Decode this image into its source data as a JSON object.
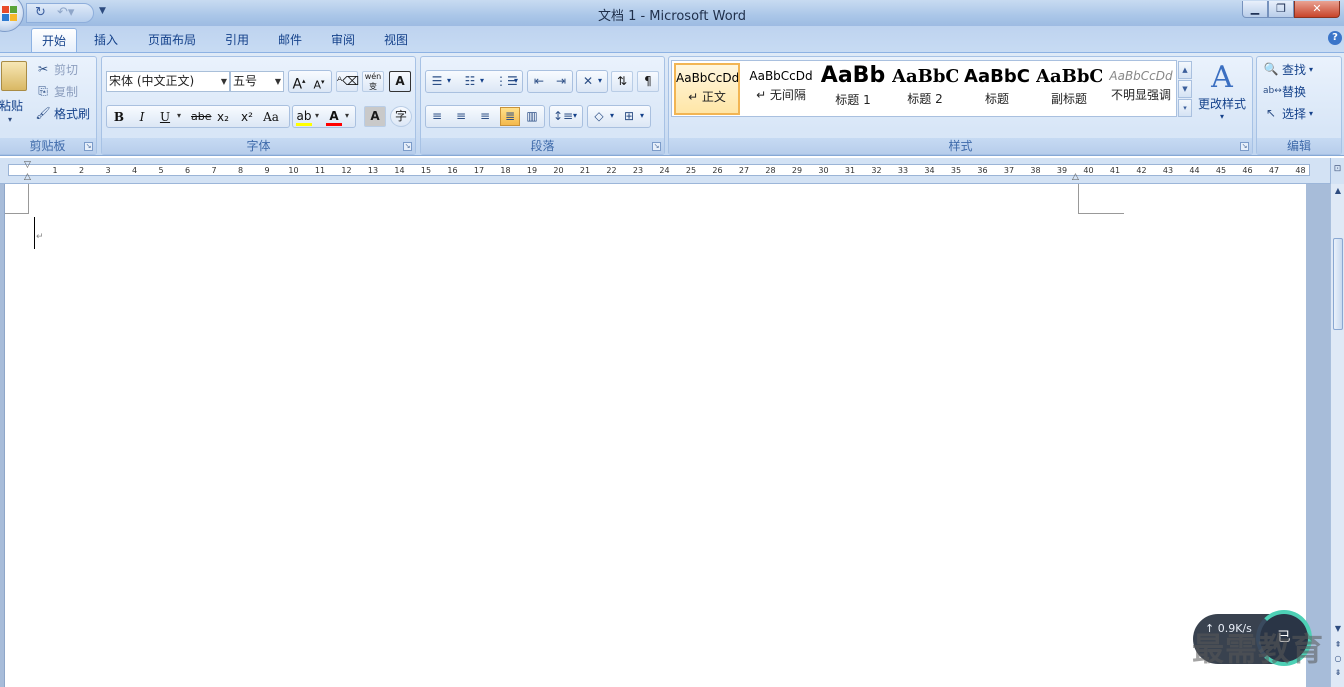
{
  "window": {
    "title": "文档 1 - Microsoft Word"
  },
  "tabs": [
    "开始",
    "插入",
    "页面布局",
    "引用",
    "邮件",
    "审阅",
    "视图"
  ],
  "clipboard": {
    "paste": "粘贴",
    "cut": "剪切",
    "copy": "复制",
    "format_painter": "格式刷",
    "label": "剪贴板"
  },
  "font": {
    "family": "宋体 (中文正文)",
    "size": "五号",
    "label": "字体",
    "phonetic_glyph": "wén",
    "change_case": "Aa",
    "bold": "B",
    "italic": "I",
    "underline": "U",
    "strike": "abe",
    "subscript": "x₂",
    "superscript": "x²"
  },
  "paragraph": {
    "label": "段落"
  },
  "styles": {
    "label": "样式",
    "items": [
      {
        "sample": "AaBbCcDd",
        "name": "↵ 正文"
      },
      {
        "sample": "AaBbCcDd",
        "name": "↵ 无间隔"
      },
      {
        "sample": "AaBb",
        "name": "标题 1"
      },
      {
        "sample": "AaBbC",
        "name": "标题 2"
      },
      {
        "sample": "AaBbC",
        "name": "标题"
      },
      {
        "sample": "AaBbC",
        "name": "副标题"
      },
      {
        "sample": "AaBbCcDd",
        "name": "不明显强调"
      }
    ],
    "change_styles": "更改样式"
  },
  "editing": {
    "find": "查找",
    "replace": "替换",
    "select": "选择",
    "label": "编辑"
  },
  "ruler": {
    "numbers": [
      "1",
      "2",
      "3",
      "4",
      "5",
      "6",
      "7",
      "8",
      "9",
      "10",
      "11",
      "12",
      "13",
      "14",
      "15",
      "16",
      "17",
      "18",
      "19",
      "20",
      "21",
      "22",
      "23",
      "24",
      "25",
      "26",
      "27",
      "28",
      "29",
      "30",
      "31",
      "32",
      "33",
      "34",
      "35",
      "36",
      "37",
      "38",
      "39",
      "40",
      "41",
      "42",
      "43",
      "44",
      "45",
      "46",
      "47",
      "48"
    ]
  },
  "overlay": {
    "net_speed": "↑ 0.9K/s",
    "ring_label": "已",
    "watermark": "最需教育"
  },
  "colors": {
    "ribbon_text": "#15428b",
    "selected_style_border": "#f2b553"
  }
}
